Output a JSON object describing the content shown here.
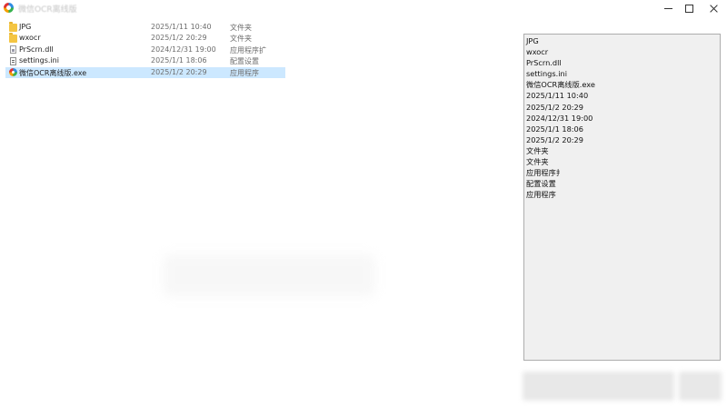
{
  "window": {
    "title": "微信OCR离线版"
  },
  "files": [
    {
      "name": "JPG",
      "date": "2025/1/11 10:40",
      "type": "文件夹",
      "icon": "folder-icon",
      "selected": false
    },
    {
      "name": "wxocr",
      "date": "2025/1/2 20:29",
      "type": "文件夹",
      "icon": "folder-icon",
      "selected": false
    },
    {
      "name": "PrScrn.dll",
      "date": "2024/12/31 19:00",
      "type": "应用程序扩",
      "icon": "dll-icon",
      "selected": false
    },
    {
      "name": "settings.ini",
      "date": "2025/1/1 18:06",
      "type": "配置设置",
      "icon": "ini-icon",
      "selected": false
    },
    {
      "name": "微信OCR离线版.exe",
      "date": "2025/1/2 20:29",
      "type": "应用程序",
      "icon": "exe-icon",
      "selected": true
    }
  ],
  "ocr_results": [
    "JPG",
    "wxocr",
    "PrScrn.dll",
    "settings.ini",
    "微信OCR离线版.exe",
    "2025/1/11 10:40",
    "2025/1/2 20:29",
    "2024/12/31 19:00",
    "2025/1/1 18:06",
    "2025/1/2 20:29",
    "文件夹",
    "文件夹",
    "应用程序扌",
    "配置设置",
    "应用程序"
  ],
  "colors": {
    "selected_row": "#cce8ff",
    "listbox_bg": "#f0f0f0",
    "folder": "#f4c542"
  }
}
